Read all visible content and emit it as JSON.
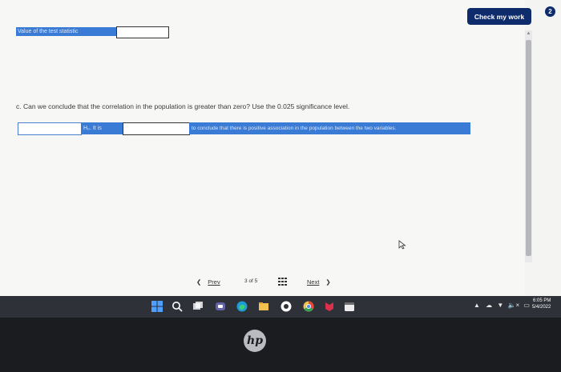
{
  "toolbar": {
    "check_label": "Check my work",
    "check_badge": "2"
  },
  "part_b": {
    "label": "Value of the test statistic",
    "input_value": ""
  },
  "part_c": {
    "question": "c. Can we conclude that the correlation in the population is greater than zero? Use the 0.025 significance level.",
    "h0_text": "H₀. It is",
    "conclusion_text": "to conclude that there is positive association in the population between the two variables.",
    "select_value": "",
    "mid_value": ""
  },
  "pager": {
    "prev": "Prev",
    "current": "3",
    "of": "of",
    "total": "5",
    "next": "Next"
  },
  "taskbar": {
    "time": "6:05 PM",
    "date": "5/4/2022"
  },
  "brand": "hp",
  "colors": {
    "highlight": "#3a7bd5",
    "button": "#0e2b6b",
    "taskbar": "#2e3137"
  }
}
